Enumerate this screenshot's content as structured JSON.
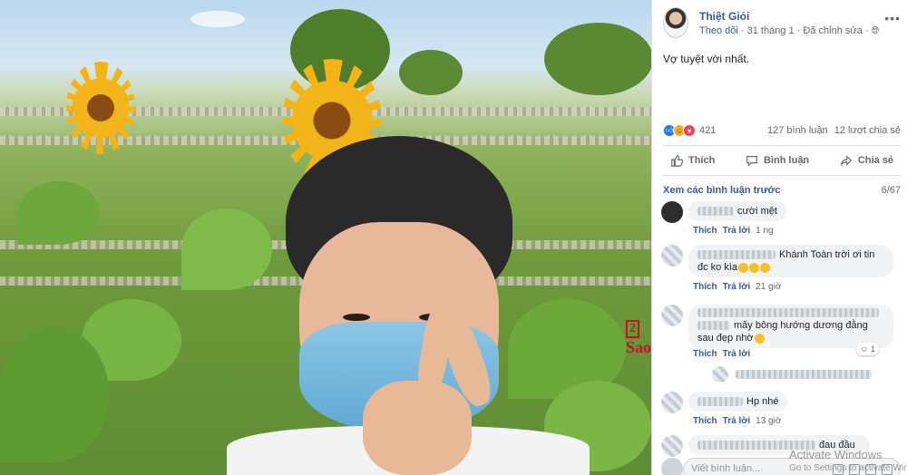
{
  "watermark": {
    "logo_number": "2",
    "logo_text": "Sao"
  },
  "post": {
    "author": "Thiệt Giỏi",
    "follow_label": "Theo dõi",
    "date": "31 tháng 1",
    "edited_label": "Đã chỉnh sửa",
    "text": "Vợ tuyệt vời nhất.",
    "reaction_count": "421",
    "comments_count": "127 bình luận",
    "shares_count": "12 lượt chia sẻ",
    "reaction_icons": [
      "like-icon",
      "haha-icon",
      "love-icon"
    ]
  },
  "actions": {
    "like_label": "Thích",
    "comment_label": "Bình luận",
    "share_label": "Chia sẻ"
  },
  "comments_header": {
    "previous_label": "Xem các bình luận trước",
    "count": "6/67"
  },
  "comments": [
    {
      "text": "cười mệt",
      "times": "1 ng"
    },
    {
      "text": "Khánh Toàn trời ơi tin đc ko kìa",
      "times": "21 giờ"
    },
    {
      "text": "mấy bông hướng dương đằng sau đẹp nhờ",
      "times": "",
      "badge": "1"
    },
    {
      "text": "Hp nhé",
      "times": "13 giờ"
    },
    {
      "text": "đau đầu",
      "times": ""
    }
  ],
  "comment_links": {
    "like": "Thích",
    "reply": "Trả lời"
  },
  "write_comment": {
    "placeholder": "Viết bình luận..."
  },
  "os_overlay": {
    "title": "Activate Windows",
    "subtitle": "Go to Settings to activate Windows."
  },
  "colors": {
    "link": "#385898",
    "meta": "#606770",
    "bubble": "#f2f3f5",
    "watermark": "#c8102e"
  }
}
